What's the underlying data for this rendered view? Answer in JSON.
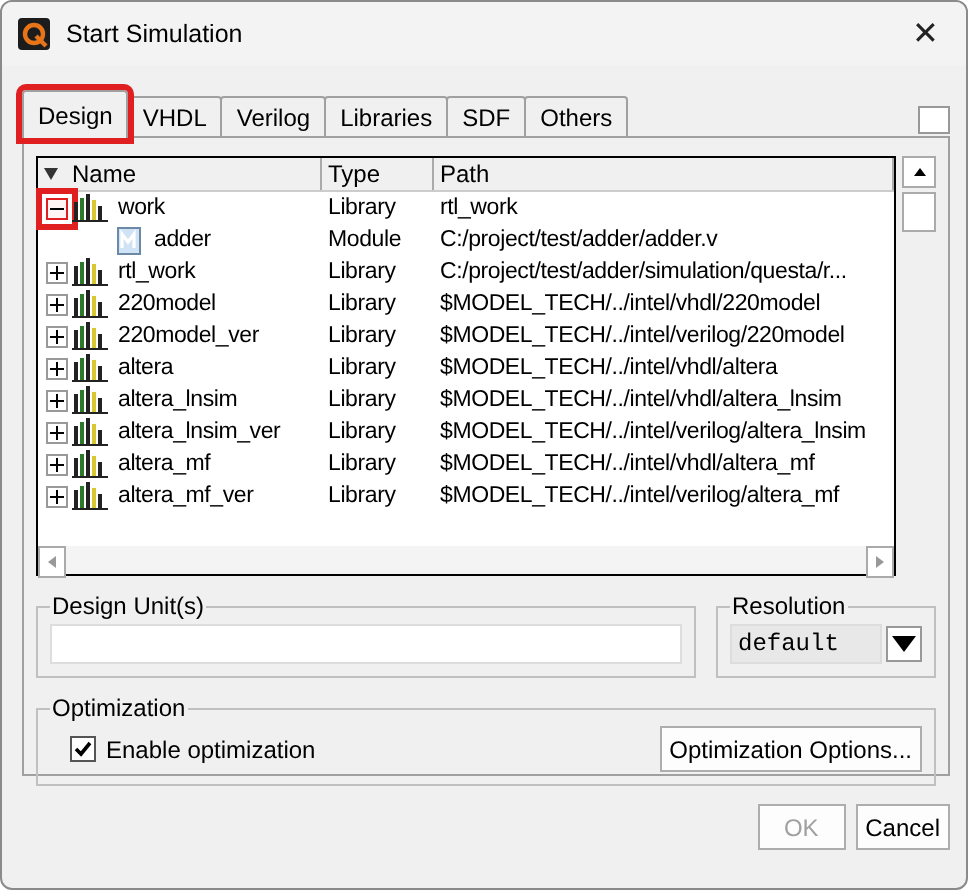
{
  "window": {
    "title": "Start Simulation",
    "close": "✕"
  },
  "tabs": [
    {
      "label": "Design",
      "selected": true,
      "highlighted": true
    },
    {
      "label": "VHDL",
      "selected": false,
      "highlighted": false
    },
    {
      "label": "Verilog",
      "selected": false,
      "highlighted": false
    },
    {
      "label": "Libraries",
      "selected": false,
      "highlighted": false
    },
    {
      "label": "SDF",
      "selected": false,
      "highlighted": false
    },
    {
      "label": "Others",
      "selected": false,
      "highlighted": false
    }
  ],
  "tree": {
    "columns": [
      "Name",
      "Type",
      "Path"
    ],
    "rows": [
      {
        "name": "work",
        "type": "Library",
        "path": "rtl_work",
        "kind": "library",
        "expanded": true,
        "highlighted": true,
        "children": [
          {
            "name": "adder",
            "type": "Module",
            "path": "C:/project/test/adder/adder.v",
            "kind": "module"
          }
        ]
      },
      {
        "name": "rtl_work",
        "type": "Library",
        "path": "C:/project/test/adder/simulation/questa/r...",
        "kind": "library",
        "expanded": false,
        "highlighted": false
      },
      {
        "name": "220model",
        "type": "Library",
        "path": "$MODEL_TECH/../intel/vhdl/220model",
        "kind": "library",
        "expanded": false,
        "highlighted": false
      },
      {
        "name": "220model_ver",
        "type": "Library",
        "path": "$MODEL_TECH/../intel/verilog/220model",
        "kind": "library",
        "expanded": false,
        "highlighted": false
      },
      {
        "name": "altera",
        "type": "Library",
        "path": "$MODEL_TECH/../intel/vhdl/altera",
        "kind": "library",
        "expanded": false,
        "highlighted": false
      },
      {
        "name": "altera_lnsim",
        "type": "Library",
        "path": "$MODEL_TECH/../intel/vhdl/altera_lnsim",
        "kind": "library",
        "expanded": false,
        "highlighted": false
      },
      {
        "name": "altera_lnsim_ver",
        "type": "Library",
        "path": "$MODEL_TECH/../intel/verilog/altera_lnsim",
        "kind": "library",
        "expanded": false,
        "highlighted": false
      },
      {
        "name": "altera_mf",
        "type": "Library",
        "path": "$MODEL_TECH/../intel/vhdl/altera_mf",
        "kind": "library",
        "expanded": false,
        "highlighted": false
      },
      {
        "name": "altera_mf_ver",
        "type": "Library",
        "path": "$MODEL_TECH/../intel/verilog/altera_mf",
        "kind": "library",
        "expanded": false,
        "highlighted": false
      }
    ]
  },
  "design_units": {
    "label": "Design Unit(s)"
  },
  "resolution": {
    "label": "Resolution",
    "value": "default"
  },
  "optimization": {
    "label": "Optimization",
    "checkbox": {
      "label": "Enable optimization",
      "checked": true
    },
    "button": "Optimization Options..."
  },
  "buttons": [
    {
      "label": "OK",
      "disabled": true
    },
    {
      "label": "Cancel",
      "disabled": false
    }
  ]
}
